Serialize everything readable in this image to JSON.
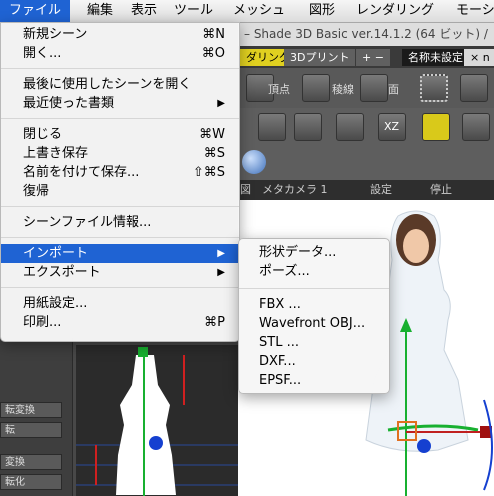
{
  "menubar": {
    "items": [
      "ファイル",
      "編集",
      "表示",
      "ツール",
      "メッシュ",
      "図形",
      "レンダリング",
      "モーシ"
    ],
    "active_index": 0
  },
  "window": {
    "title": "– Shade 3D Basic ver.14.1.2 (64 ビット) /",
    "tabs": [
      "ダリング",
      "3Dプリント",
      "+ −",
      "名称未設定",
      "× n"
    ],
    "tool_labels": [
      "頂点",
      "稜線",
      "面",
      "XZ"
    ],
    "view_bar": [
      "図",
      "メタカメラ 1",
      "設定",
      "停止"
    ],
    "left_buttons": [
      "転変換",
      "転",
      "変換",
      "転化"
    ]
  },
  "file_menu": {
    "items": [
      {
        "label": "新規シーン",
        "shortcut": "⌘N"
      },
      {
        "label": "開く...",
        "shortcut": "⌘O"
      },
      {
        "separator": true
      },
      {
        "label": "最後に使用したシーンを開く"
      },
      {
        "label": "最近使った書類",
        "submenu": "▶"
      },
      {
        "separator": true
      },
      {
        "label": "閉じる",
        "shortcut": "⌘W"
      },
      {
        "label": "上書き保存",
        "shortcut": "⌘S"
      },
      {
        "label": "名前を付けて保存...",
        "shortcut": "⇧⌘S"
      },
      {
        "label": "復帰"
      },
      {
        "separator": true
      },
      {
        "label": "シーンファイル情報..."
      },
      {
        "separator": true
      },
      {
        "label": "インポート",
        "submenu": "▶",
        "highlighted": true
      },
      {
        "label": "エクスポート",
        "submenu": "▶"
      },
      {
        "separator": true
      },
      {
        "label": "用紙設定..."
      },
      {
        "label": "印刷...",
        "shortcut": "⌘P"
      }
    ]
  },
  "import_submenu": {
    "items": [
      {
        "label": "形状データ..."
      },
      {
        "label": "ポーズ..."
      },
      {
        "separator": true
      },
      {
        "label": "FBX ..."
      },
      {
        "label": "Wavefront OBJ..."
      },
      {
        "label": "STL ..."
      },
      {
        "label": "DXF..."
      },
      {
        "label": "EPSF..."
      }
    ]
  },
  "colors": {
    "highlight": "#1f63d3",
    "menu_bg": "#f6f6f6",
    "tab_active": "#e0d020",
    "tab_3dprint": "#606060",
    "tab_title": "#1a1a1a"
  }
}
